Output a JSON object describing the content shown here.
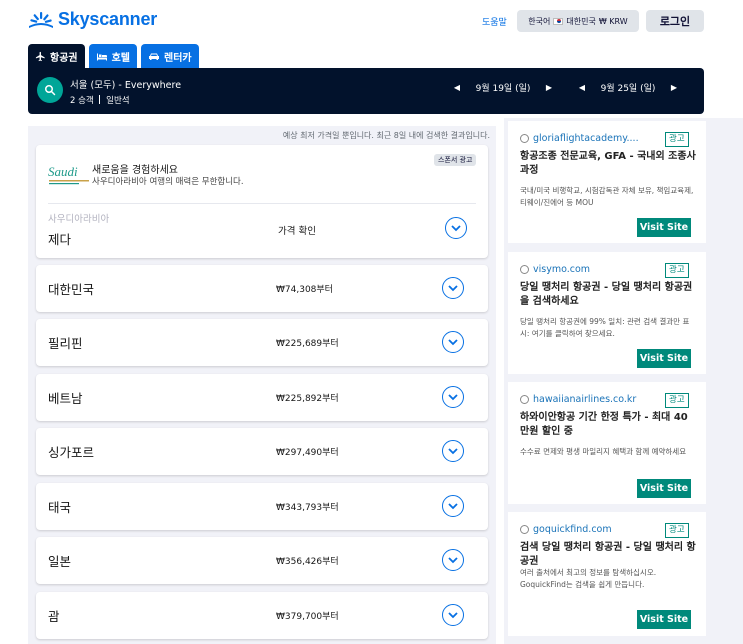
{
  "header": {
    "brand": "Skyscanner",
    "help": "도움말",
    "locale": {
      "language": "한국어",
      "country": "대한민국",
      "currency": "₩ KRW"
    },
    "login": "로그인"
  },
  "tabs": [
    {
      "label": "항공권",
      "icon": "plane-icon",
      "active": true
    },
    {
      "label": "호텔",
      "icon": "bed-icon",
      "active": false
    },
    {
      "label": "렌터카",
      "icon": "car-icon",
      "active": false
    }
  ],
  "search": {
    "route": "서울 (모두) - Everywhere",
    "travellers": "2 승객",
    "cabin": "일반석",
    "depart_date": "9월 19일 (일)",
    "return_date": "9월 25일 (일)",
    "prev_arrow": "◀",
    "next_arrow": "▶"
  },
  "results": {
    "notice": "예상 최저 가격일 뿐입니다. 최근 8일 내에 검색한 결과입니다.",
    "promo": {
      "title": "새로움을 경험하세요",
      "subtitle": "사우디아라비아 여행의 매력은 무한합니다.",
      "sponsor": "스폰서 광고",
      "country": "사우디아라비아",
      "city": "제다",
      "price": "가격 확인",
      "logo_text": "Saudi"
    },
    "items": [
      {
        "name": "대한민국",
        "price": "₩74,308부터"
      },
      {
        "name": "필리핀",
        "price": "₩225,689부터"
      },
      {
        "name": "베트남",
        "price": "₩225,892부터"
      },
      {
        "name": "싱가포르",
        "price": "₩297,490부터"
      },
      {
        "name": "태국",
        "price": "₩343,793부터"
      },
      {
        "name": "일본",
        "price": "₩356,426부터"
      },
      {
        "name": "괌",
        "price": "₩379,700부터"
      }
    ]
  },
  "ads": [
    {
      "domain": "gloriaflightacademy....",
      "badge": "광고",
      "headline": "항공조종 전문교육, GFA - 국내외 조종사 과정",
      "desc": "국내/미국 비행학교, 시험감독관 자체 보유, 책임교육제, 티웨이/진에어 등 MOU",
      "cta": "Visit Site"
    },
    {
      "domain": "visymo.com",
      "badge": "광고",
      "headline": "당일 땡처리 항공권 - 당일 땡처리 항공권을 검색하세요",
      "desc": "당일 땡처리 항공권에 99% 일치: 관련 검색 결과만 표시: 여기를 클릭하여 찾으세요.",
      "cta": "Visit Site"
    },
    {
      "domain": "hawaiianairlines.co.kr",
      "badge": "광고",
      "headline": "하와이안항공 기간 한정 특가 - 최대 40만원 할인 중",
      "desc": "수수료 면제와 평생 마일리지 혜택과 함께 예약하세요",
      "cta": "Visit Site"
    },
    {
      "domain": "goquickfind.com",
      "badge": "광고",
      "headline": "검색 당일 땡처리 항공권 - 당일 땡처리 항공권",
      "desc": "여러 출처에서 최고의 정보를 탐색하십시오. GoquickFind는 검색을 쉽게 만듭니다.",
      "cta": "Visit Site"
    }
  ],
  "colors": {
    "brand_blue": "#0770e3",
    "navy": "#02122c",
    "teal": "#00a698",
    "ad_green": "#00897b"
  }
}
